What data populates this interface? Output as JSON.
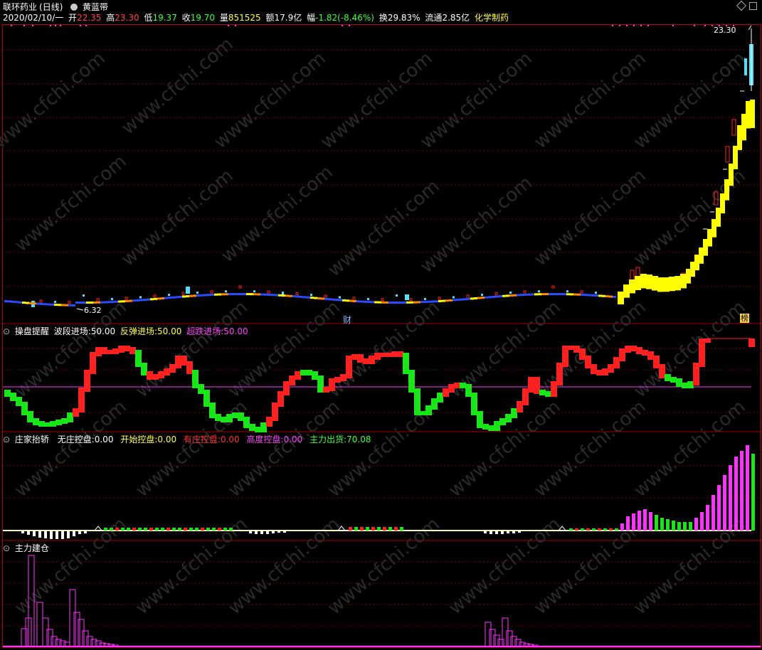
{
  "colors": {
    "bg": "#000000",
    "frame": "#b00000",
    "grid": "#7a0000",
    "red": "#ff2020",
    "green": "#19e619",
    "yellow": "#ffff00",
    "cyan": "#55e0ff",
    "magenta": "#ff33ff",
    "white": "#ffffff",
    "blue": "#2a4cff"
  },
  "header": {
    "stock_name": "联环药业",
    "period": "(日线)",
    "indicator_icon": "circle-dot-icon",
    "indicator_name": "黄蓝带",
    "date": "2020/02/10/一",
    "open_label": "开",
    "open_value": "22.35",
    "high_label": "高",
    "high_value": "23.30",
    "low_label": "低",
    "low_value": "19.37",
    "close_label": "收",
    "close_value": "19.70",
    "volume_label": "量",
    "volume_value": "851525",
    "amount_label": "额",
    "amount_value": "17.9亿",
    "change_label": "幅",
    "change_value": "-1.82(-8.46%)",
    "turnover_label": "换",
    "turnover_value": "29.83%",
    "float_label": "流通",
    "float_value": "2.85亿",
    "sector": "化学制药"
  },
  "main_chart": {
    "high_marker": "23.30",
    "low_marker": "6.32",
    "badges": [
      "财",
      "榜"
    ]
  },
  "panel2": {
    "title": "操盘提醒",
    "items": [
      {
        "label": "波段进场:",
        "value": "50.00"
      },
      {
        "label": "反弹进场:",
        "value": "50.00"
      },
      {
        "label": "超跌进场:",
        "value": "50.00"
      }
    ]
  },
  "panel3": {
    "title": "庄家抬轿",
    "items": [
      {
        "label": "无庄控盘:",
        "value": "0.00"
      },
      {
        "label": "开始控盘:",
        "value": "0.00"
      },
      {
        "label": "有庄控盘:",
        "value": "0.00"
      },
      {
        "label": "高度控盘:",
        "value": "0.00"
      },
      {
        "label": "主力出货:",
        "value": "70.08"
      }
    ]
  },
  "panel4": {
    "title": "主力建仓"
  },
  "watermark": "www.cfchi.com"
}
